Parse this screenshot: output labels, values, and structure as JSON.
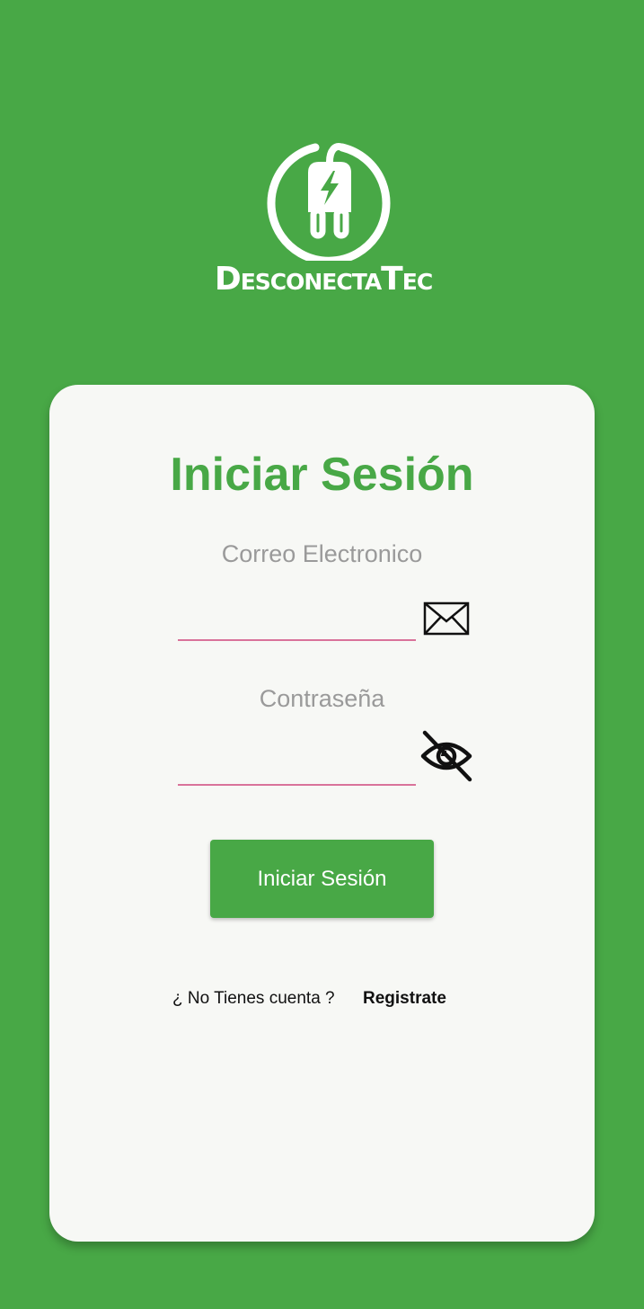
{
  "colors": {
    "background": "#48a846",
    "card": "#f7f8f5",
    "accent": "#48a846",
    "input_underline": "#d9739a",
    "label_gray": "#9a9a9a"
  },
  "logo": {
    "icon": "plug-bolt-logo-icon",
    "brand_text": "DesconectaTec"
  },
  "login": {
    "title": "Iniciar Sesión",
    "email_label": "Correo Electronico",
    "email_value": "",
    "email_icon": "envelope-icon",
    "password_label": "Contraseña",
    "password_value": "",
    "password_icon": "eye-off-icon",
    "submit_label": "Iniciar Sesión",
    "no_account_text": "¿ No Tienes cuenta ?",
    "register_label": "Registrate"
  }
}
